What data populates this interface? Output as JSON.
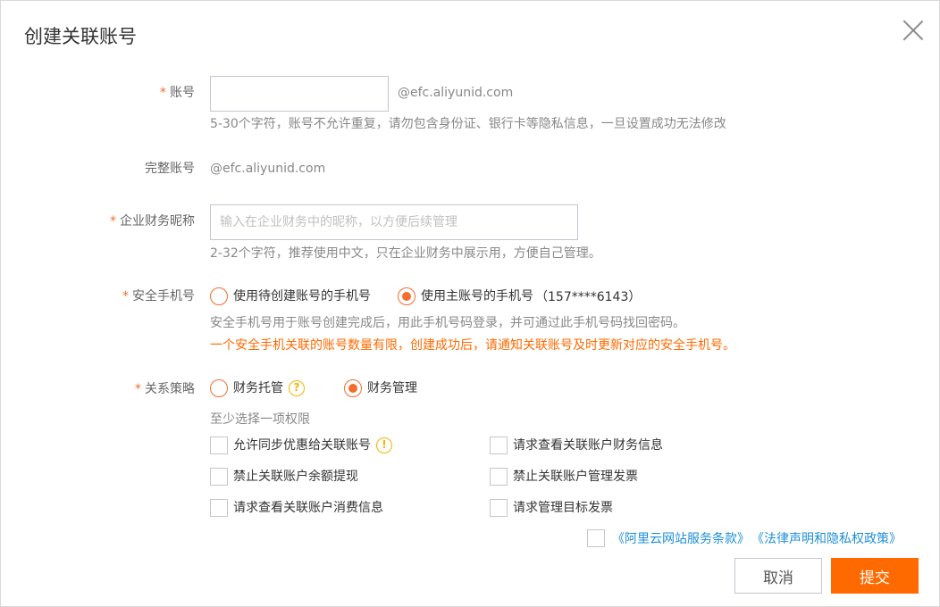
{
  "dialog": {
    "title": "创建关联账号"
  },
  "account": {
    "label": "账号",
    "value": "",
    "suffix": "@efc.aliyunid.com",
    "help": "5-30个字符，账号不允许重复，请勿包含身份证、银行卡等隐私信息，一旦设置成功无法修改"
  },
  "full_account": {
    "label": "完整账号",
    "value": "@efc.aliyunid.com"
  },
  "nickname": {
    "label": "企业财务昵称",
    "placeholder": "输入在企业财务中的昵称，以方便后续管理",
    "help": "2-32个字符，推荐使用中文，只在企业财务中展示用，方便自己管理。"
  },
  "phone": {
    "label": "安全手机号",
    "option1": "使用待创建账号的手机号",
    "option2": "使用主账号的手机号",
    "option2_number": "（157****6143）",
    "selected": "option2",
    "help": "安全手机号用于账号创建完成后，用此手机号码登录，并可通过此手机号码找回密码。",
    "warning": "一个安全手机关联的账号数量有限，创建成功后，请通知关联账号及时更新对应的安全手机号。"
  },
  "policy": {
    "label": "关系策略",
    "option1": "财务托管",
    "option2": "财务管理",
    "selected": "option2",
    "permissions_title": "至少选择一项权限",
    "permissions": [
      "允许同步优惠给关联账号",
      "请求查看关联账户财务信息",
      "禁止关联账户余额提现",
      "禁止关联账户管理发票",
      "请求查看关联账户消费信息",
      "请求管理目标发票"
    ]
  },
  "agreement": {
    "link1": "《阿里云网站服务条款》",
    "link2": "《法律声明和隐私权政策》"
  },
  "buttons": {
    "cancel": "取消",
    "submit": "提交"
  },
  "colors": {
    "accent": "#ff6a00",
    "radio": "#f56c2d",
    "link": "#1e8fd6",
    "info_icon": "#f5b400"
  }
}
